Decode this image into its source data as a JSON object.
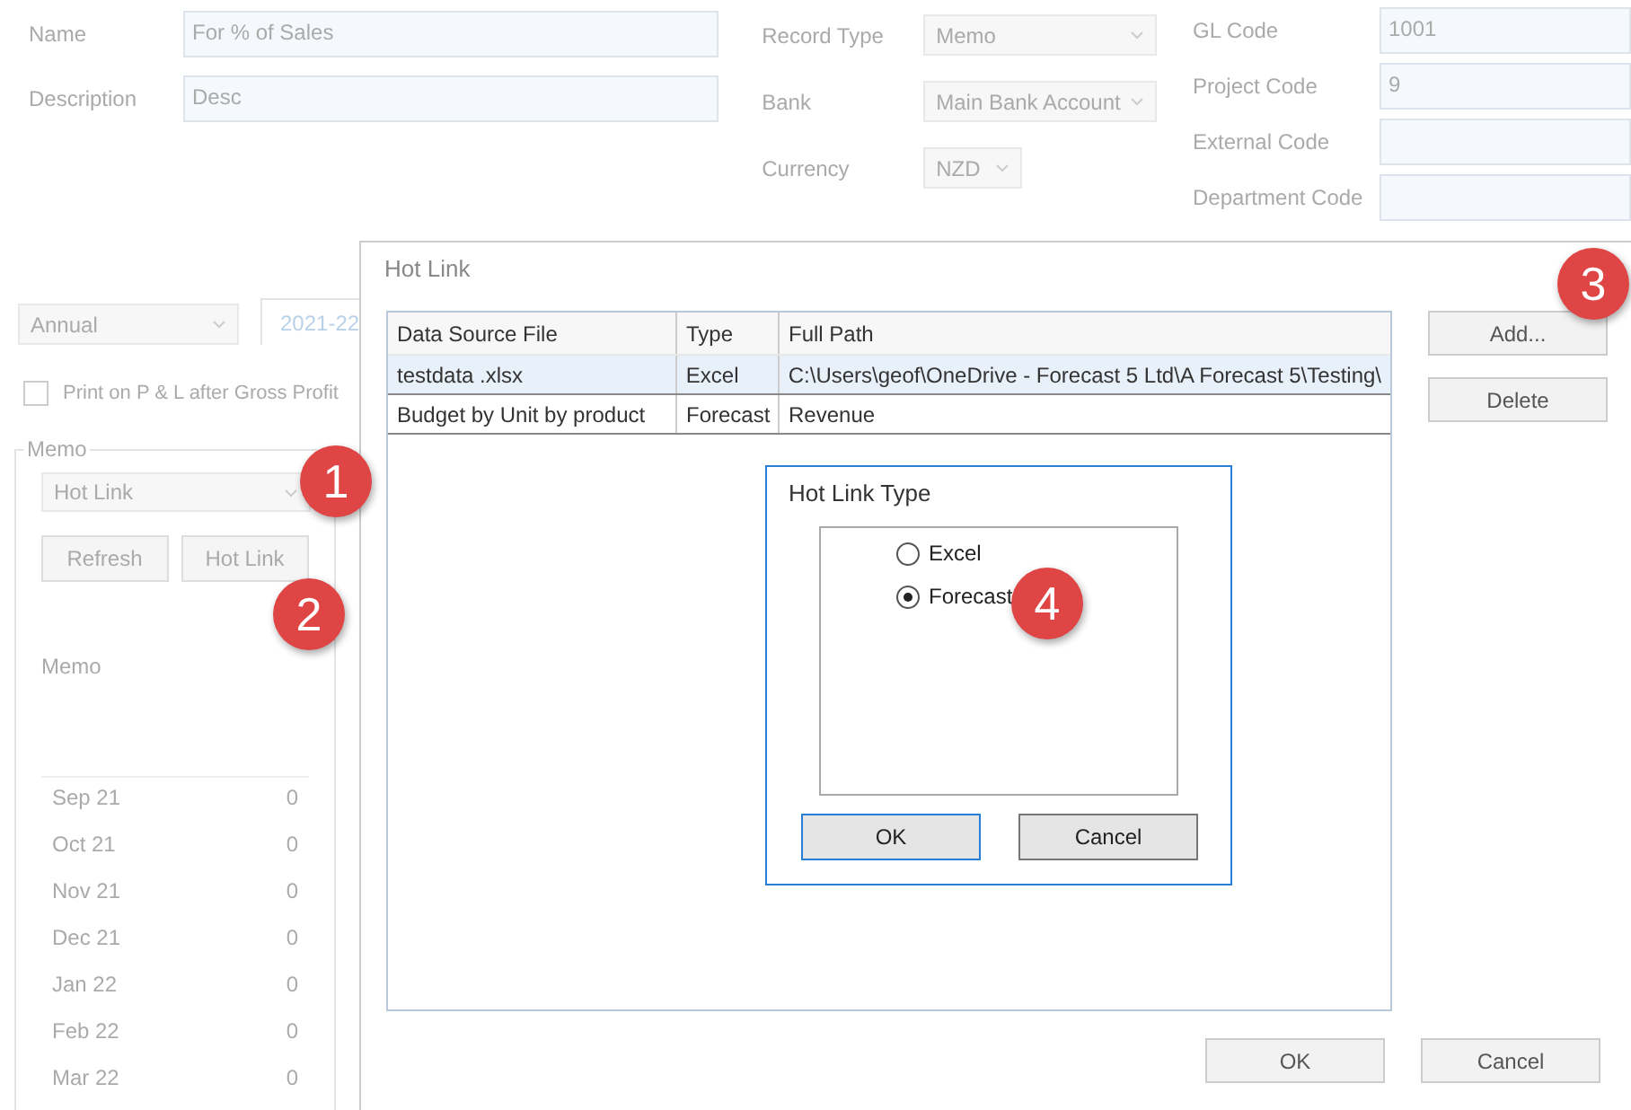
{
  "form": {
    "left_fields": [
      {
        "label": "Name",
        "value": "For % of Sales"
      },
      {
        "label": "Description",
        "value": "Desc"
      }
    ],
    "middle_fields": [
      {
        "label": "Record Type",
        "value": "Memo"
      },
      {
        "label": "Bank",
        "value": "Main Bank Account"
      },
      {
        "label": "Currency",
        "value": "NZD"
      }
    ],
    "right_fields": [
      {
        "label": "GL Code",
        "value": "1001"
      },
      {
        "label": "Project Code",
        "value": "9"
      },
      {
        "label": "External Code"
      },
      {
        "label": "Department Code"
      }
    ]
  },
  "period_select": "Annual",
  "year_tab": "2021-22",
  "print_checkbox": {
    "label": "Print on P & L after Gross Profit",
    "checked": false
  },
  "memo_group": {
    "title": "Memo",
    "source_select": "Hot Link",
    "buttons": [
      "Refresh",
      "Hot Link"
    ],
    "memo_label": "Memo",
    "months": [
      {
        "month": "Sep 21",
        "value": "0"
      },
      {
        "month": "Oct 21",
        "value": "0"
      },
      {
        "month": "Nov 21",
        "value": "0"
      },
      {
        "month": "Dec 21",
        "value": "0"
      },
      {
        "month": "Jan 22",
        "value": "0"
      },
      {
        "month": "Feb 22",
        "value": "0"
      },
      {
        "month": "Mar 22",
        "value": "0"
      }
    ]
  },
  "hot_link_dialog": {
    "title": "Hot Link",
    "table": {
      "columns": [
        "Data Source File",
        "Type",
        "Full Path"
      ],
      "rows": [
        {
          "cells": [
            "testdata .xlsx",
            "Excel",
            "C:\\Users\\geof\\OneDrive - Forecast 5 Ltd\\A Forecast 5\\Testing\\"
          ],
          "selected": true
        },
        {
          "cells": [
            "Budget by Unit by product",
            "Forecast",
            "Revenue"
          ],
          "selected": false
        }
      ]
    },
    "side_buttons": [
      "Add...",
      "Delete"
    ],
    "buttons": [
      "OK",
      "Cancel"
    ]
  },
  "hot_link_type_dialog": {
    "title": "Hot Link Type",
    "options": [
      {
        "label": "Excel",
        "selected": false
      },
      {
        "label": "Forecast",
        "selected": true
      }
    ],
    "buttons": [
      {
        "label": "OK",
        "default": true
      },
      {
        "label": "Cancel",
        "default": false
      }
    ]
  },
  "callouts": [
    "1",
    "2",
    "3",
    "4"
  ]
}
